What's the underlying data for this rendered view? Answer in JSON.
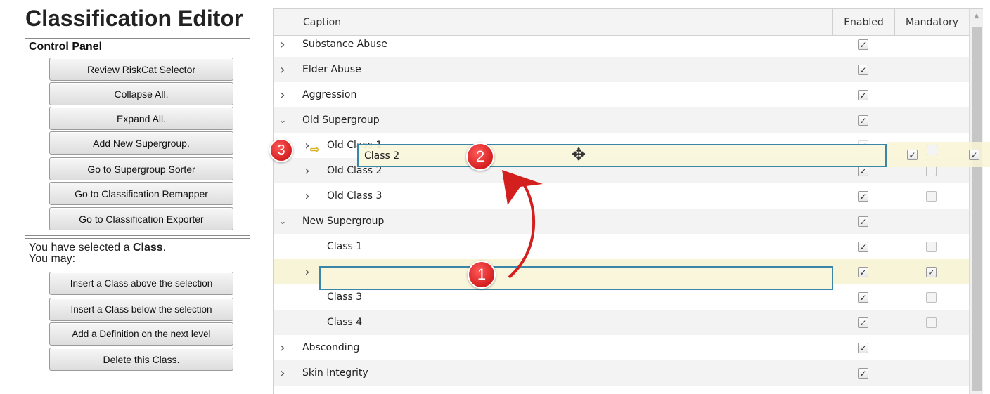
{
  "app_title": "Classification Editor",
  "control_panel": {
    "heading": "Control Panel",
    "buttons": [
      "Review RiskCat Selector",
      "Collapse All.",
      "Expand All.",
      "Add New Supergroup.",
      "Go to Supergroup Sorter",
      "Go to Classification Remapper",
      "Go to Classification Exporter"
    ]
  },
  "selection_panel": {
    "line1_prefix": "You have selected a ",
    "line1_bold": "Class",
    "line1_suffix": ".",
    "line2": "You may:",
    "buttons": [
      "Insert a Class above the selection",
      "Insert a Class below the selection",
      "Add a Definition on the next level",
      "Delete this Class."
    ]
  },
  "grid": {
    "columns": {
      "caption": "Caption",
      "enabled": "Enabled",
      "mandatory": "Mandatory"
    },
    "rows": [
      {
        "caption": "Substance Abuse",
        "level": 0,
        "expander": "collapsed",
        "enabled": true,
        "mandatory": null
      },
      {
        "caption": "Elder Abuse",
        "level": 0,
        "expander": "collapsed",
        "enabled": true,
        "mandatory": null
      },
      {
        "caption": "Aggression",
        "level": 0,
        "expander": "collapsed",
        "enabled": true,
        "mandatory": null
      },
      {
        "caption": "Old Supergroup",
        "level": 0,
        "expander": "expanded",
        "enabled": true,
        "mandatory": null
      },
      {
        "caption": "Old Class 1",
        "level": 1,
        "expander": "collapsed",
        "enabled": true,
        "mandatory": false
      },
      {
        "caption": "Old Class 2",
        "level": 1,
        "expander": "collapsed",
        "enabled": true,
        "mandatory": false
      },
      {
        "caption": "Old Class 3",
        "level": 1,
        "expander": "collapsed",
        "enabled": true,
        "mandatory": false
      },
      {
        "caption": "New Supergroup",
        "level": 0,
        "expander": "expanded",
        "enabled": true,
        "mandatory": null
      },
      {
        "caption": "Class 1",
        "level": 1,
        "expander": "none",
        "enabled": true,
        "mandatory": false
      },
      {
        "caption": "Class 2",
        "level": 1,
        "expander": "collapsed",
        "enabled": true,
        "mandatory": true,
        "selected": true
      },
      {
        "caption": "Class 3",
        "level": 1,
        "expander": "none",
        "enabled": true,
        "mandatory": false
      },
      {
        "caption": "Class 4",
        "level": 1,
        "expander": "none",
        "enabled": true,
        "mandatory": false
      },
      {
        "caption": "Absconding",
        "level": 0,
        "expander": "collapsed",
        "enabled": true,
        "mandatory": null
      },
      {
        "caption": "Skin Integrity",
        "level": 0,
        "expander": "collapsed",
        "enabled": true,
        "mandatory": null
      }
    ],
    "drag_ghost_caption": "Class 2"
  },
  "annotations": {
    "step1": "1",
    "step2": "2",
    "step3": "3"
  },
  "icons": {
    "expander_collapsed": "chevron-right-icon",
    "expander_expanded": "chevron-down-icon",
    "check": "checkmark-icon",
    "move": "move-cursor-icon",
    "drop": "drop-position-arrow-icon"
  },
  "colors": {
    "selection_border": "#3a86a8",
    "selection_fill": "#faf6dc",
    "marker": "#d41f1f"
  }
}
